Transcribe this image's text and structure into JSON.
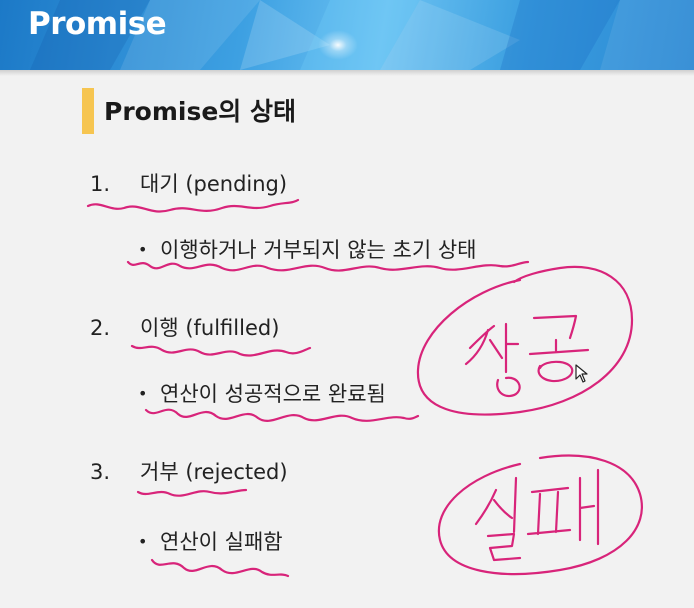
{
  "header": {
    "title": "Promise"
  },
  "section": {
    "title": "Promise의 상태"
  },
  "items": [
    {
      "number": "1.",
      "label": "대기 (pending)",
      "bullet": "이행하거나 거부되지 않는 초기 상태"
    },
    {
      "number": "2.",
      "label": "이행 (fulfilled)",
      "bullet": "연산이 성공적으로 완료됨"
    },
    {
      "number": "3.",
      "label": "거부 (rejected)",
      "bullet": "연산이 실패함"
    }
  ],
  "annotations": {
    "ink_color": "#d8247a",
    "circled_words": [
      "성공",
      "실패"
    ]
  },
  "colors": {
    "header_blue": "#2a87d3",
    "section_bar": "#f6c550",
    "background": "#f2f2f2"
  }
}
